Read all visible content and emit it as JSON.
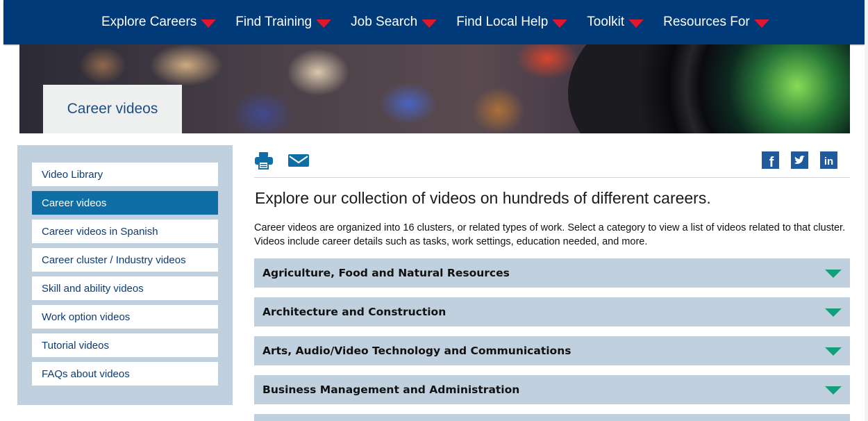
{
  "nav": {
    "items": [
      {
        "label": "Explore Careers"
      },
      {
        "label": "Find Training"
      },
      {
        "label": "Job Search"
      },
      {
        "label": "Find Local Help"
      },
      {
        "label": "Toolkit"
      },
      {
        "label": "Resources For"
      }
    ]
  },
  "hero": {
    "title": "Career videos"
  },
  "sidebar": {
    "items": [
      {
        "label": "Video Library"
      },
      {
        "label": "Career videos"
      },
      {
        "label": "Career videos in Spanish"
      },
      {
        "label": "Career cluster / Industry videos"
      },
      {
        "label": "Skill and ability videos"
      },
      {
        "label": "Work option videos"
      },
      {
        "label": "Tutorial videos"
      },
      {
        "label": "FAQs about videos"
      }
    ],
    "active": "Career videos"
  },
  "tools": {
    "icons": [
      "print-icon",
      "email-icon"
    ]
  },
  "share": {
    "icons": [
      "facebook-icon",
      "twitter-icon",
      "linkedin-icon"
    ]
  },
  "main": {
    "heading": "Explore our collection of videos on hundreds of different careers.",
    "intro": "Career videos are organized into 16 clusters, or related types of work. Select a category to view a list of videos related to that cluster. Videos include career details such as tasks, work settings, education needed, and more.",
    "accordions": [
      {
        "title": "Agriculture, Food and Natural Resources"
      },
      {
        "title": "Architecture and Construction"
      },
      {
        "title": "Arts, Audio/Video Technology and Communications"
      },
      {
        "title": "Business Management and Administration"
      }
    ]
  },
  "colors": {
    "nav_bg": "#003a78",
    "nav_caret": "#e0182d",
    "accent": "#0f6ea5",
    "panel": "#c0d0de",
    "accordion_caret": "#12a17a"
  }
}
